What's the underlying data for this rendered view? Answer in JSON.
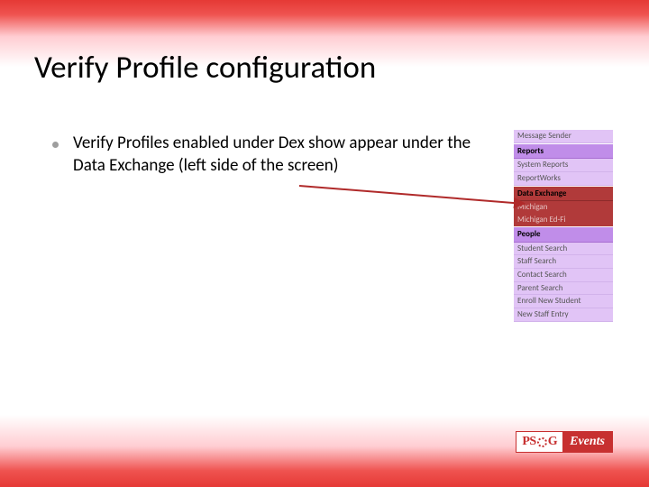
{
  "title": "Verify Profile configuration",
  "bullet": "Verify Profiles enabled under Dex show appear under the Data Exchange (left side of the screen)",
  "sidebar": {
    "preceding_item": "Message Sender",
    "sections": [
      {
        "header": "Reports",
        "items": [
          "System Reports",
          "ReportWorks"
        ],
        "selected": false
      },
      {
        "header": "Data Exchange",
        "items": [
          "Michigan",
          "Michigan Ed-Fi"
        ],
        "selected": true
      },
      {
        "header": "People",
        "items": [
          "Student Search",
          "Staff Search",
          "Contact Search",
          "Parent Search",
          "Enroll New Student",
          "New Staff Entry"
        ],
        "selected": false
      }
    ]
  },
  "logo": {
    "left_p": "PS",
    "left_g": "G",
    "right": "Events"
  }
}
